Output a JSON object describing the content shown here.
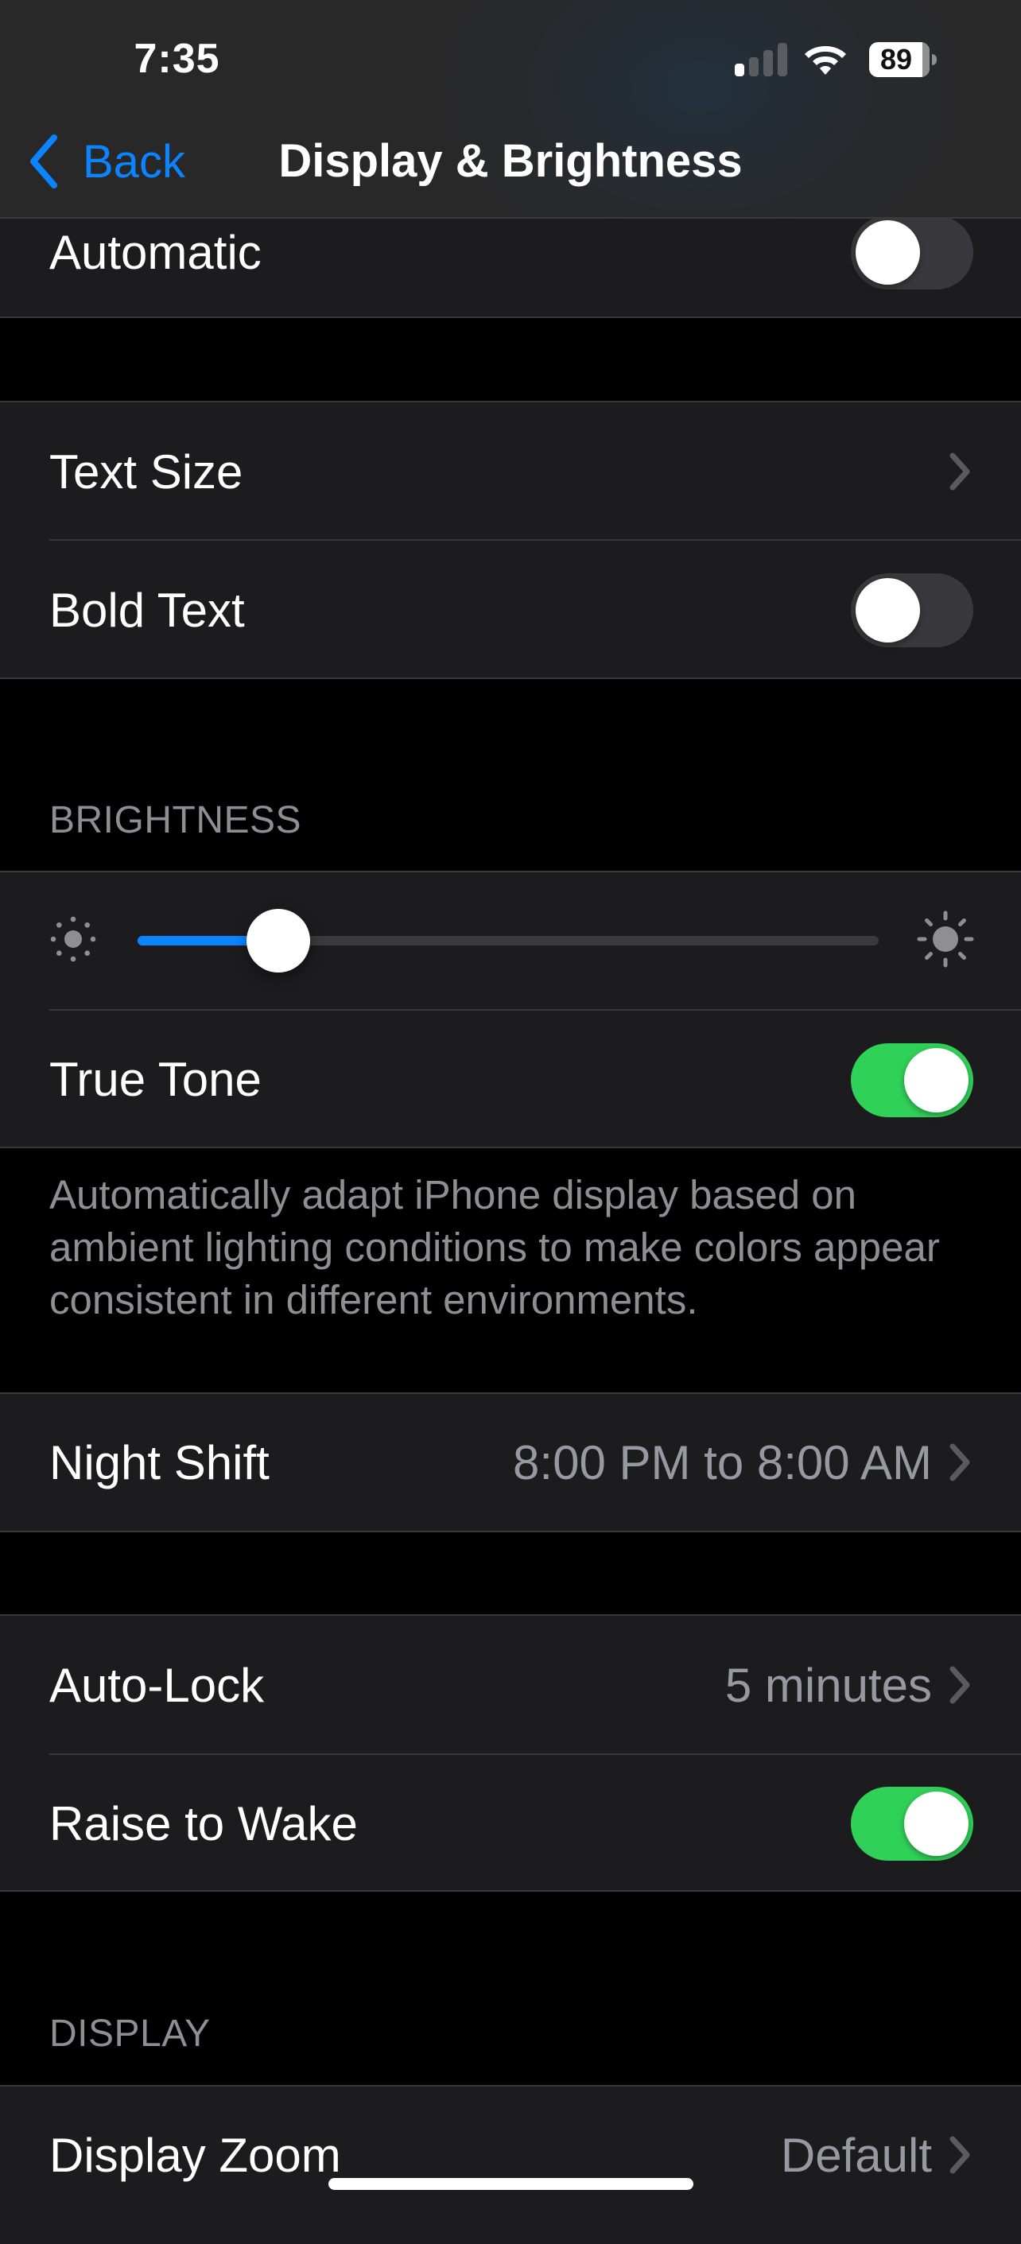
{
  "status_bar": {
    "time": "7:35",
    "signal_bars_active": 1,
    "signal_bars_total": 4,
    "wifi_icon": "wifi-icon",
    "battery_percent": "89"
  },
  "nav": {
    "back_label": "Back",
    "title": "Display & Brightness"
  },
  "colors": {
    "accent": "#0a84ff",
    "toggle_on": "#30d158",
    "row_bg": "#1c1c1e",
    "secondary_text": "#98989f"
  },
  "appearance": {
    "automatic": {
      "label": "Automatic",
      "on": false
    }
  },
  "text_group": {
    "text_size": {
      "label": "Text Size"
    },
    "bold_text": {
      "label": "Bold Text",
      "on": false
    }
  },
  "brightness": {
    "header": "BRIGHTNESS",
    "slider_value": 0.19,
    "min_icon": "sun-min-icon",
    "max_icon": "sun-max-icon",
    "true_tone": {
      "label": "True Tone",
      "on": true
    },
    "footer": "Automatically adapt iPhone display based on ambient lighting conditions to make colors appear consistent in different environments."
  },
  "night_shift": {
    "label": "Night Shift",
    "value": "8:00 PM to 8:00 AM"
  },
  "lock_group": {
    "auto_lock": {
      "label": "Auto-Lock",
      "value": "5 minutes"
    },
    "raise_to_wake": {
      "label": "Raise to Wake",
      "on": true
    }
  },
  "display": {
    "header": "DISPLAY",
    "display_zoom": {
      "label": "Display Zoom",
      "value": "Default"
    }
  }
}
